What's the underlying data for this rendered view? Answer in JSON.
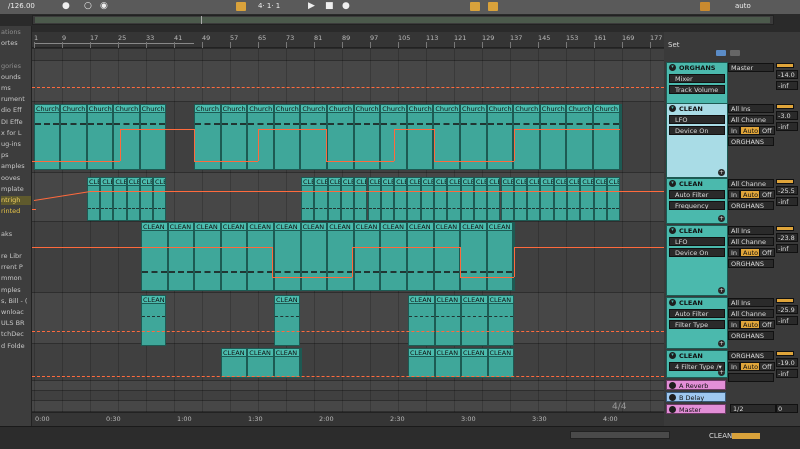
{
  "topbar": {
    "tempo": "/126.00",
    "position": "4· 1· 1",
    "auto_label": "auto",
    "set_label": "Set"
  },
  "sidebar": {
    "items": [
      {
        "label": "ations",
        "style": "dim"
      },
      {
        "label": "ortes",
        "style": "normal"
      },
      {
        "label": "",
        "style": "normal"
      },
      {
        "label": "gories",
        "style": "dim"
      },
      {
        "label": "ounds",
        "style": "normal"
      },
      {
        "label": "ms",
        "style": "normal"
      },
      {
        "label": "rument",
        "style": "normal"
      },
      {
        "label": "dio Eff",
        "style": "normal"
      },
      {
        "label": "DI Effe",
        "style": "normal"
      },
      {
        "label": "x for L",
        "style": "normal"
      },
      {
        "label": "ug-ins",
        "style": "normal"
      },
      {
        "label": "ps",
        "style": "normal"
      },
      {
        "label": "amples",
        "style": "normal"
      },
      {
        "label": "ooves",
        "style": "normal"
      },
      {
        "label": "mplate",
        "style": "normal"
      },
      {
        "label": "ntrigh",
        "style": "sel"
      },
      {
        "label": "rinted",
        "style": "hi"
      },
      {
        "label": "",
        "style": "normal"
      },
      {
        "label": "aks",
        "style": "normal"
      },
      {
        "label": "",
        "style": "normal"
      },
      {
        "label": "re Libr",
        "style": "normal"
      },
      {
        "label": "rrent P",
        "style": "normal"
      },
      {
        "label": "mmon",
        "style": "normal"
      },
      {
        "label": "mples",
        "style": "normal"
      },
      {
        "label": "s, Bill - (",
        "style": "normal"
      },
      {
        "label": "wnloac",
        "style": "normal"
      },
      {
        "label": "ULS BR",
        "style": "normal"
      },
      {
        "label": "tchDec",
        "style": "normal"
      },
      {
        "label": "d Folde",
        "style": "normal"
      }
    ]
  },
  "ruler": {
    "bars": [
      "1",
      "9",
      "17",
      "25",
      "33",
      "41",
      "49",
      "57",
      "65",
      "73",
      "81",
      "89",
      "97",
      "105",
      "113",
      "121",
      "129",
      "137",
      "145",
      "153",
      "161",
      "169",
      "177"
    ]
  },
  "timeline": {
    "labels": [
      "0:00",
      "0:30",
      "1:00",
      "1:30",
      "2:00",
      "2:30",
      "3:00",
      "3:30",
      "4:00"
    ],
    "time_signature": "4/4"
  },
  "clips": {
    "church": "Church",
    "cle": "CLE",
    "clean2": "CLEAN 2",
    "clean4": "CLEAN 4",
    "clean5": "CLEAN 5"
  },
  "tracks": [
    {
      "name": "ORGHANS",
      "device": "Mixer",
      "param": "Track Volume",
      "io": "Master",
      "vol1": "-14.0",
      "vol2": "-inf"
    },
    {
      "name": "CLEAN",
      "device": "LFO",
      "param": "Device On",
      "io": "All Ins",
      "io2": "All Channe",
      "io3": "ORGHANS",
      "vol1": "-3.0",
      "vol2": "-inf"
    },
    {
      "name": "CLEAN",
      "device": "Auto Filter",
      "param": "Frequency",
      "io": "All Channe",
      "io3": "ORGHANS",
      "vol1": "-25.5",
      "vol2": "-inf"
    },
    {
      "name": "CLEAN",
      "device": "LFO",
      "param": "Device On",
      "io": "All Ins",
      "io2": "All Channe",
      "io3": "ORGHANS",
      "vol1": "-23.8",
      "vol2": "-inf"
    },
    {
      "name": "CLEAN",
      "device": "Auto Filter",
      "param": "Filter Type",
      "io": "All Ins",
      "io2": "All Channe",
      "io3": "ORGHANS",
      "vol1": "-25.9",
      "vol2": "-inf"
    },
    {
      "name": "CLEAN",
      "device": "4 Filter Type /▾",
      "param": "",
      "io": "ORGHANS",
      "vol1": "-19.0",
      "vol2": "-inf"
    }
  ],
  "monitor": {
    "in": "In",
    "auto": "Auto",
    "off": "Off"
  },
  "returns": [
    {
      "name": "A Reverb"
    },
    {
      "name": "B Delay"
    },
    {
      "name": "Master",
      "io": "1/2",
      "vol": "0"
    }
  ],
  "footer": {
    "clip": "CLEAN"
  },
  "colors": {
    "clip": "#3fa79a",
    "automation": "#ff6a3d",
    "selected_header": "#a9dce6",
    "return_pink": "#e38fd7",
    "return_blue": "#9fc8f0"
  }
}
